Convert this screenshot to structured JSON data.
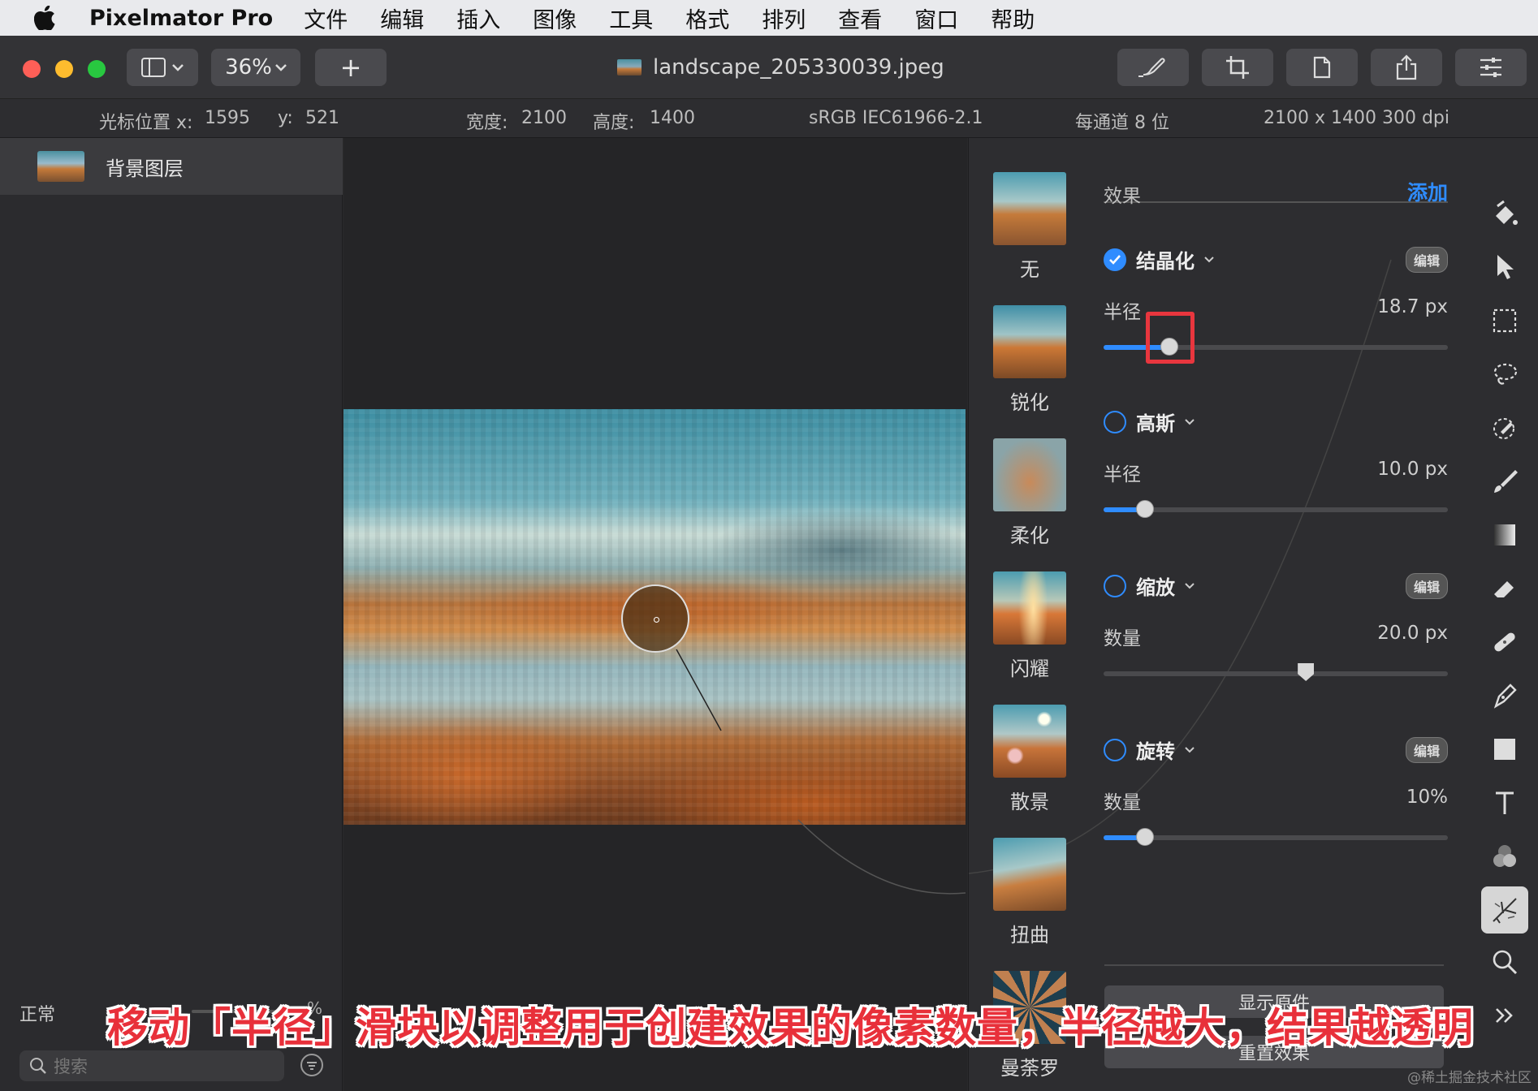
{
  "menubar": {
    "app_name": "Pixelmator Pro",
    "items": [
      "文件",
      "编辑",
      "插入",
      "图像",
      "工具",
      "格式",
      "排列",
      "查看",
      "窗口",
      "帮助"
    ]
  },
  "toolbar": {
    "zoom": "36%",
    "add_label": "+",
    "document_title": "landscape_205330039.jpeg"
  },
  "infobar": {
    "cursor_x_label": "光标位置 x:",
    "cursor_x": "1595",
    "cursor_y_label": "y:",
    "cursor_y": "521",
    "width_label": "宽度:",
    "width": "2100",
    "height_label": "高度:",
    "height": "1400",
    "color_profile": "sRGB IEC61966-2.1",
    "bit_depth": "每通道 8 位",
    "dimensions_dpi": "2100 x 1400 300 dpi"
  },
  "layers": {
    "items": [
      {
        "name": "背景图层"
      }
    ],
    "blend_mode": "正常",
    "opacity_suffix": "%",
    "search_placeholder": "搜索"
  },
  "presets": [
    {
      "label": "无"
    },
    {
      "label": "锐化"
    },
    {
      "label": "柔化"
    },
    {
      "label": "闪耀"
    },
    {
      "label": "散景"
    },
    {
      "label": "扭曲"
    },
    {
      "label": "曼荼罗"
    }
  ],
  "effects_panel": {
    "header": "效果",
    "add_label": "添加",
    "edit_label": "编辑",
    "effects": [
      {
        "name": "结晶化",
        "enabled": true,
        "param": "半径",
        "value": "18.7 px",
        "level": 0.19
      },
      {
        "name": "高斯",
        "enabled": false,
        "param": "半径",
        "value": "10.0 px",
        "level": 0.12
      },
      {
        "name": "缩放",
        "enabled": false,
        "param": "数量",
        "value": "20.0 px",
        "level": 0.59
      },
      {
        "name": "旋转",
        "enabled": false,
        "param": "数量",
        "value": "10%",
        "level": 0.12
      }
    ],
    "show_original_label": "显示原件",
    "reset_label": "重置效果"
  },
  "caption": "移动「半径」滑块以调整用于创建效果的像素数量，半径越大，结果越透明",
  "watermark": "@稀土掘金技术社区",
  "colors": {
    "accent": "#2f8cff",
    "highlight_box": "#e8363e",
    "caption_text": "#e8303a"
  },
  "icons": [
    "apple-icon",
    "sidebar-toggle-icon",
    "chevron-down-icon",
    "plus-icon",
    "brush-icon",
    "crop-icon",
    "document-icon",
    "share-icon",
    "adjustments-icon",
    "paint-bucket-icon",
    "arrow-pointer-icon",
    "rect-select-icon",
    "lasso-icon",
    "color-picker-icon",
    "paintbrush-icon",
    "gradient-icon",
    "eraser-icon",
    "bandage-icon",
    "pen-icon",
    "shape-icon",
    "text-icon",
    "color-adjust-icon",
    "effects-icon",
    "search-icon",
    "more-icon",
    "filter-icon"
  ]
}
